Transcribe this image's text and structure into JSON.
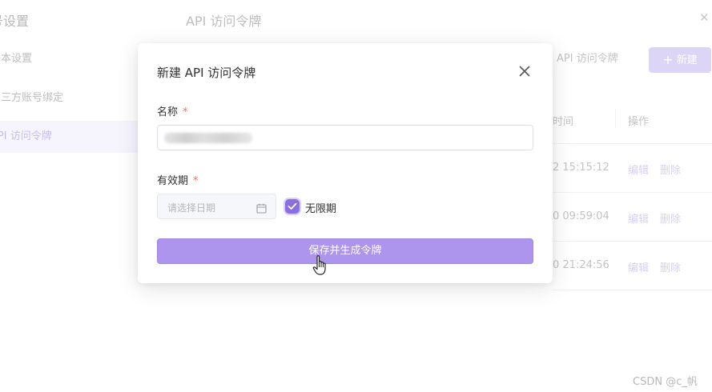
{
  "background": {
    "sidebar": {
      "title": "号设置",
      "items": [
        {
          "label": "基本设置"
        },
        {
          "label": "第三方账号绑定"
        },
        {
          "label": "API 访问令牌"
        }
      ]
    },
    "header": {
      "title": "API 访问令牌",
      "tab_label": "API 访问令牌",
      "new_button_label": "新建"
    },
    "table": {
      "columns": [
        "时间",
        "操作"
      ],
      "rows": [
        {
          "time": "2 15:15:12",
          "edit": "编辑",
          "delete": "删除"
        },
        {
          "time": "0 09:59:04",
          "edit": "编辑",
          "delete": "删除"
        },
        {
          "time": "0 21:24:56",
          "edit": "编辑",
          "delete": "删除"
        }
      ]
    }
  },
  "modal": {
    "title": "新建 API 访问令牌",
    "name_label": "名称",
    "required_mark": "*",
    "expiry_label": "有效期",
    "date_placeholder": "请选择日期",
    "no_expiry_label": "无限期",
    "no_expiry_checked": true,
    "save_button_label": "保存并生成令牌"
  },
  "watermark": "CSDN @c_帆",
  "colors": {
    "accent": "#8a6fe0",
    "button": "#ad94ec",
    "required": "#f56c6c"
  },
  "icons": [
    "close-icon",
    "calendar-icon",
    "check-icon",
    "plus-icon",
    "hand-pointer-cursor"
  ]
}
